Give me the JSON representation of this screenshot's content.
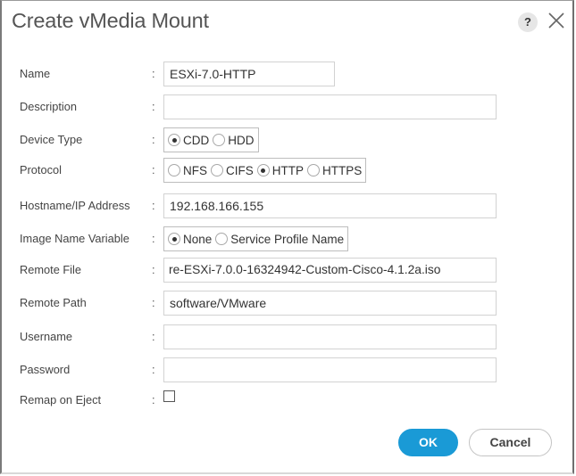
{
  "dialog": {
    "title": "Create vMedia Mount",
    "help_label": "?",
    "help_icon": "help-icon",
    "close_icon": "close-icon"
  },
  "form": {
    "name": {
      "label": "Name",
      "value": "ESXi-7.0-HTTP"
    },
    "description": {
      "label": "Description",
      "value": ""
    },
    "device_type": {
      "label": "Device Type",
      "options": [
        {
          "label": "CDD",
          "selected": true
        },
        {
          "label": "HDD",
          "selected": false
        }
      ]
    },
    "protocol": {
      "label": "Protocol",
      "options": [
        {
          "label": "NFS",
          "selected": false
        },
        {
          "label": "CIFS",
          "selected": false
        },
        {
          "label": "HTTP",
          "selected": true
        },
        {
          "label": "HTTPS",
          "selected": false
        }
      ]
    },
    "hostname": {
      "label": "Hostname/IP Address",
      "value": "192.168.166.155"
    },
    "image_name_variable": {
      "label": "Image Name Variable",
      "options": [
        {
          "label": "None",
          "selected": true
        },
        {
          "label": "Service Profile Name",
          "selected": false
        }
      ]
    },
    "remote_file": {
      "label": "Remote File",
      "value": "re-ESXi-7.0.0-16324942-Custom-Cisco-4.1.2a.iso"
    },
    "remote_path": {
      "label": "Remote Path",
      "value": "software/VMware"
    },
    "username": {
      "label": "Username",
      "value": ""
    },
    "password": {
      "label": "Password",
      "value": ""
    },
    "remap_on_eject": {
      "label": "Remap on Eject",
      "checked": false
    },
    "separator": ":"
  },
  "buttons": {
    "ok": "OK",
    "cancel": "Cancel"
  },
  "colors": {
    "primary": "#1a9ad6"
  }
}
